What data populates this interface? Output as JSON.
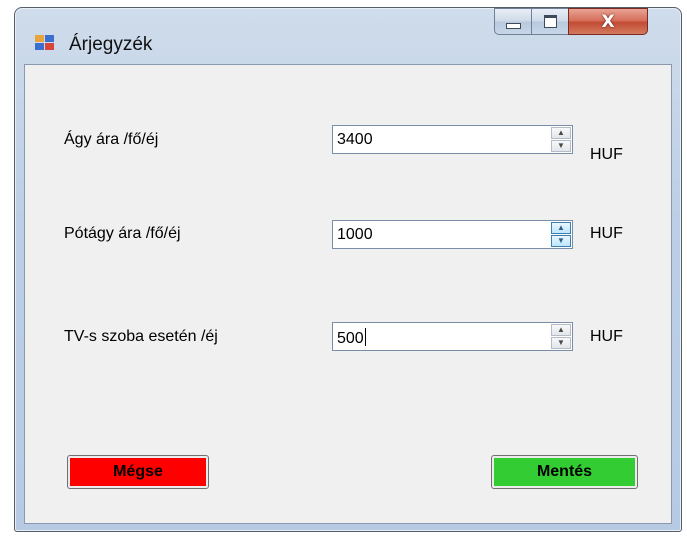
{
  "window": {
    "title": "Árjegyzék",
    "controls": {
      "minimize_icon": "minimize-icon",
      "maximize_icon": "maximize-icon",
      "close_label": "X"
    }
  },
  "colors": {
    "cancel_bg": "#ff0000",
    "save_bg": "#33cc33",
    "client_bg": "#f0f0f0"
  },
  "fields": [
    {
      "label": "Ágy ára /fő/éj",
      "value": "3400",
      "unit": "HUF"
    },
    {
      "label": "Pótágy ára /fő/éj",
      "value": "1000",
      "unit": "HUF"
    },
    {
      "label": "TV-s szoba esetén /éj",
      "value": "500",
      "unit": "HUF"
    }
  ],
  "buttons": {
    "cancel": "Mégse",
    "save": "Mentés"
  }
}
